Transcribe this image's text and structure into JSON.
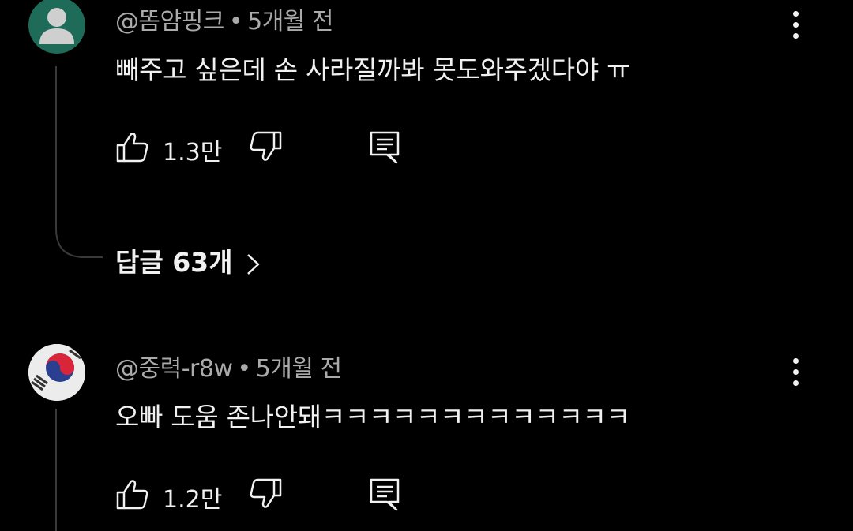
{
  "colors": {
    "background": "#000000",
    "text_primary": "#f1f1f1",
    "text_secondary": "#aaaaaa",
    "thread_line": "#3a3a3a",
    "avatar1_bg": "#1f6b5a",
    "avatar1_fg": "#cfcfcf"
  },
  "comments": [
    {
      "author": "@똠얌핑크",
      "separator": "•",
      "time": "5개월 전",
      "text": "빼주고 싶은데 손 사라질까봐 못도와주겠다야 ㅠ",
      "likes": "1.3만",
      "avatar_icon": "default-person-icon",
      "replies_label": "답글 63개"
    },
    {
      "author": "@중력-r8w",
      "separator": "•",
      "time": "5개월 전",
      "text": "오빠 도움 존나안돼ㅋㅋㅋㅋㅋㅋㅋㅋㅋㅋㅋㅋㅋ",
      "likes": "1.2만",
      "avatar_icon": "korean-flag-icon"
    }
  ],
  "icons": {
    "like": "thumbs-up-icon",
    "dislike": "thumbs-down-icon",
    "reply": "reply-comment-icon",
    "menu": "more-vert-icon",
    "chevron": "chevron-right-icon"
  }
}
